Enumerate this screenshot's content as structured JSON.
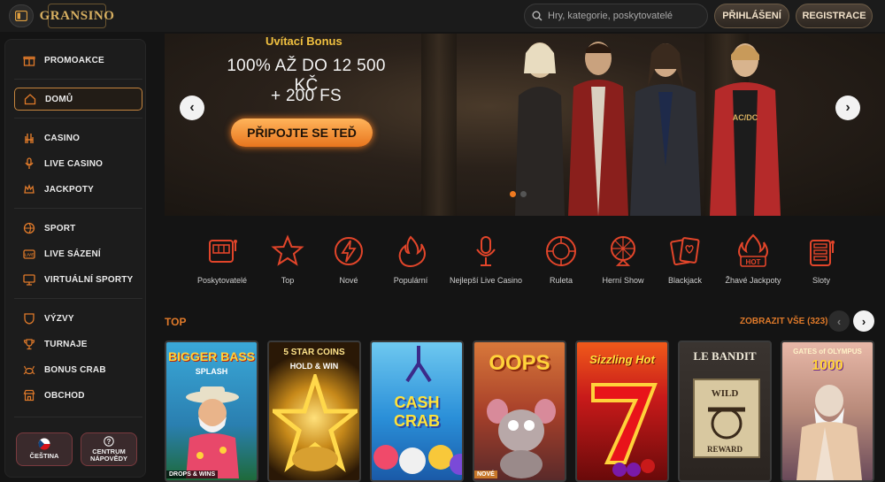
{
  "header": {
    "logo_text": "GRANSINO",
    "search_placeholder": "Hry, kategorie, poskytovatelé",
    "login_label": "PŘIHLÁŠENÍ",
    "register_label": "REGISTRACE"
  },
  "sidebar": {
    "promo": "PROMOAKCE",
    "home": "DOMŮ",
    "casino": "CASINO",
    "live_casino": "LIVE CASINO",
    "jackpots": "JACKPOTY",
    "sport": "SPORT",
    "live_betting": "LIVE SÁZENÍ",
    "virtual_sports": "VIRTUÁLNÍ SPORTY",
    "challenges": "VÝZVY",
    "tournaments": "TURNAJE",
    "bonus_crab": "BONUS CRAB",
    "shop": "OBCHOD",
    "language": "ČEŠTINA",
    "help_line1": "CENTRUM",
    "help_line2": "NÁPOVĚDY"
  },
  "banner": {
    "subtitle": "Uvítací Bonus",
    "line1": "100% AŽ DO 12 500 KČ",
    "line2": "+ 200 FS",
    "cta": "PŘIPOJTE SE TEĎ"
  },
  "categories": {
    "providers": "Poskytovatelé",
    "top": "Top",
    "new": "Nové",
    "popular": "Populární",
    "best_live": "Nejlepší Live Casino",
    "roulette": "Ruleta",
    "game_show": "Herní Show",
    "blackjack": "Blackjack",
    "hot_jackpots": "Žhavé Jackpoty",
    "slots": "Sloty"
  },
  "top_section": {
    "title": "TOP",
    "view_all": "ZOBRAZIT VŠE (323)"
  },
  "games": {
    "g1_title": "BIGGER BASS",
    "g1_sub": "SPLASH",
    "g1_badge": "DROPS & WINS",
    "g2_title": "5 STAR COINS",
    "g2_sub": "HOLD & WIN",
    "g3_title": "CASH CRAB",
    "g4_title": "OOPS",
    "g4_badge": "NOVÉ",
    "g5_title": "Sizzling Hot",
    "g6_title": "LE BANDIT",
    "g6_sub1": "WILD",
    "g6_sub2": "REWARD",
    "g7_title": "GATES of OLYMPUS",
    "g7_sub": "1000"
  },
  "colors": {
    "accent": "#e07a2a",
    "gold": "#f0c040",
    "icon_red": "#e2452a"
  }
}
